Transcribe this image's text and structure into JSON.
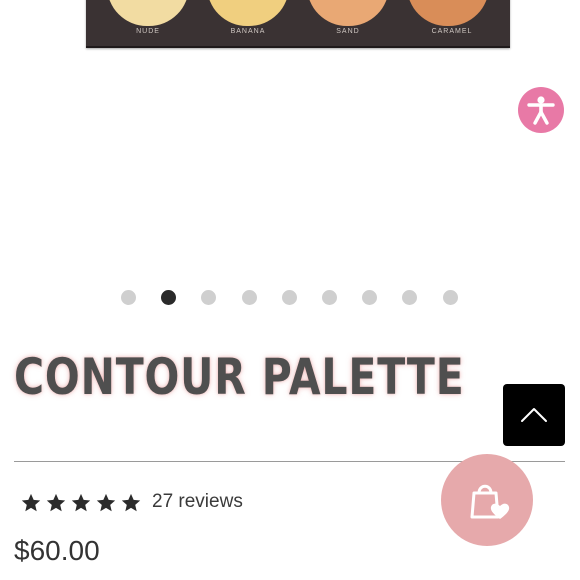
{
  "product_image": {
    "shades": [
      {
        "name": "NUDE",
        "color": "#f2dca2"
      },
      {
        "name": "BANANA",
        "color": "#f0cf7f"
      },
      {
        "name": "SAND",
        "color": "#e9a874"
      },
      {
        "name": "CARAMEL",
        "color": "#d98d58"
      }
    ]
  },
  "carousel": {
    "total_slides": 9,
    "active_index": 1
  },
  "product": {
    "title": "CONTOUR PALETTE",
    "rating": 5,
    "reviews_label": "27 reviews",
    "price": "$60.00"
  },
  "icons": {
    "accessibility": "accessibility-icon",
    "back_to_top": "chevron-up-icon",
    "wishlist": "shopping-bag-heart-icon",
    "star": "star-icon"
  },
  "colors": {
    "accessibility_bg": "#e879a6",
    "wishlist_bg": "#e6a9ab",
    "title": "#4f4f4f",
    "active_dot": "#2a2a2a",
    "inactive_dot": "#cfcfcf"
  }
}
